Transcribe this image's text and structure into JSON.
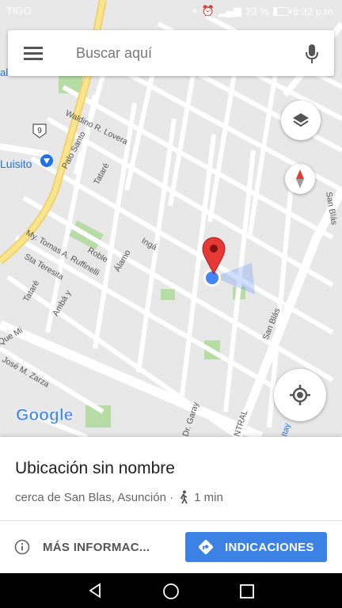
{
  "status_bar": {
    "carrier": "TIGO",
    "battery": "23 %",
    "time": "6:32 p.m.",
    "battery_level": 0.23
  },
  "search": {
    "placeholder": "Buscar aquí"
  },
  "map": {
    "road_labels": {
      "waldino": "Waldino R. Lovera",
      "palo_santo": "Palo Santo",
      "tatare_top": "Tataré",
      "tomas": "My. Tomas A. Ruffinelli",
      "roble": "Roble",
      "alamo": "Álamo",
      "inga": "Ingá",
      "sta_teresita": "Sta Teresita",
      "tatare_low": "Tataré",
      "amba": "Ambá y",
      "que_mi": "Que Mi",
      "jose_zarza": "José M. Zarza",
      "garay": "Dr. Garay",
      "san_blas_right": "San Blás",
      "san_blas_mid": "San Blás",
      "ntral": "NTRAL",
      "route_number": "9",
      "luisito": "Luisito",
      "edge_al": "al",
      "edge_bottom": "Itay"
    },
    "google_logo": "Google",
    "colors": {
      "pin": "#e53935",
      "location": "#4285f4",
      "park": "#b8dca5",
      "road_major": "#f7d774",
      "road": "#ffffff",
      "bg": "#e8e8e8"
    }
  },
  "place": {
    "title": "Ubicación sin nombre",
    "subtitle": "cerca de San Blas, Asunción ·",
    "walk_time": "1 min"
  },
  "actions": {
    "more_info": "MÁS INFORMAC...",
    "directions": "INDICACIONES"
  },
  "icons": {
    "menu": "menu-icon",
    "mic": "mic-icon",
    "layers": "layers-icon",
    "compass": "compass-icon",
    "my_location": "my-location-icon",
    "info": "info-icon",
    "walk": "walk-icon",
    "directions": "directions-icon"
  }
}
